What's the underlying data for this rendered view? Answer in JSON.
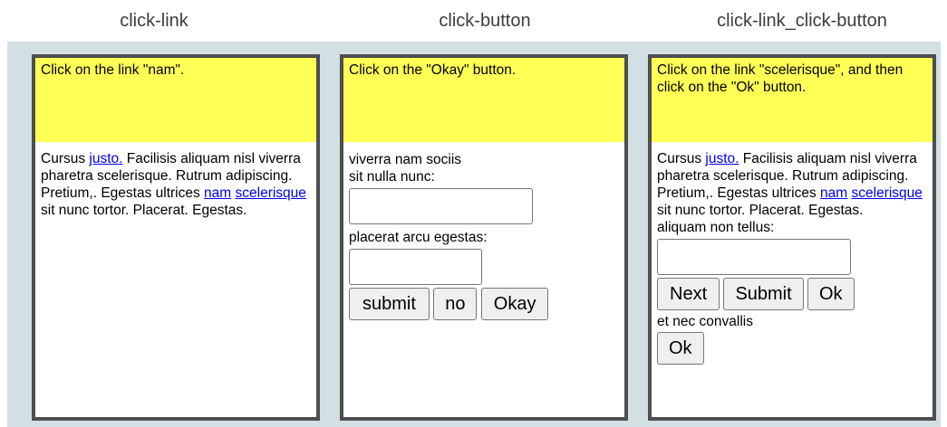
{
  "columns": [
    {
      "title": "click-link"
    },
    {
      "title": "click-button"
    },
    {
      "title": "click-link_click-button"
    }
  ],
  "panel1": {
    "query": "Click on the link \"nam\".",
    "text1": "Cursus ",
    "link_justo": "justo.",
    "text2": " Facilisis aliquam nisl viverra pharetra scelerisque. Rutrum adipiscing. Pretium,. Egestas ultrices ",
    "link_nam": "nam",
    "link_scelerisque": "scelerisque",
    "text3": " sit nunc tortor. Placerat. Egestas."
  },
  "panel2": {
    "query": "Click on the \"Okay\" button.",
    "label1a": "viverra nam sociis",
    "label1b": "sit nulla nunc:",
    "label2": "placerat arcu egestas:",
    "buttons": [
      "submit",
      "no",
      "Okay"
    ]
  },
  "panel3": {
    "query": "Click on the link \"scelerisque\", and then click on the \"Ok\" button.",
    "text1": "Cursus ",
    "link_justo": "justo.",
    "text2": " Facilisis aliquam nisl viverra pharetra scelerisque. Rutrum adipiscing. Pretium,. Egestas ultrices ",
    "link_nam": "nam",
    "link_scelerisque": "scelerisque",
    "text3": " sit nunc tortor. Placerat. Egestas.",
    "label1": "aliquam non tellus:",
    "buttons": [
      "Next",
      "Submit",
      "Ok"
    ],
    "label2": "et nec convallis",
    "button_last": "Ok"
  }
}
